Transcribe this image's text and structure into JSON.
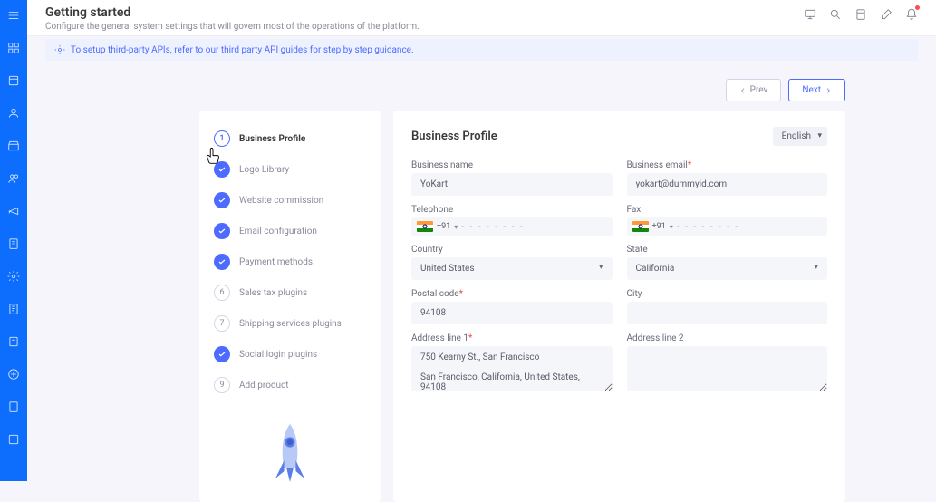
{
  "header": {
    "title": "Getting started",
    "subtitle": "Configure the general system settings that will govern most of the operations of the platform."
  },
  "info_bar": "To setup third-party APIs, refer to our third party API guides for step by step guidance.",
  "nav": {
    "prev": "Prev",
    "next": "Next"
  },
  "steps": [
    {
      "label": "Business Profile",
      "state": "current",
      "num": "1"
    },
    {
      "label": "Logo Library",
      "state": "done"
    },
    {
      "label": "Website commission",
      "state": "done"
    },
    {
      "label": "Email configuration",
      "state": "done"
    },
    {
      "label": "Payment methods",
      "state": "done"
    },
    {
      "label": "Sales tax plugins",
      "state": "pending",
      "num": "6"
    },
    {
      "label": "Shipping services plugins",
      "state": "pending",
      "num": "7"
    },
    {
      "label": "Social login plugins",
      "state": "done"
    },
    {
      "label": "Add product",
      "state": "pending",
      "num": "9"
    }
  ],
  "form": {
    "title": "Business Profile",
    "language": "English",
    "labels": {
      "business_name": "Business name",
      "business_email": "Business email",
      "telephone": "Telephone",
      "fax": "Fax",
      "country": "Country",
      "state": "State",
      "postal_code": "Postal code",
      "city": "City",
      "address1": "Address line 1",
      "address2": "Address line 2"
    },
    "values": {
      "business_name": "YoKart",
      "business_email": "yokart@dummyid.com",
      "dial_code": "+91",
      "phone_placeholder": "- - - - - - - -",
      "country": "United States",
      "state": "California",
      "postal_code": "94108",
      "city": "",
      "address1": "750 Kearny St., San Francisco\n\nSan Francisco, California, United States, 94108",
      "address2": ""
    }
  }
}
